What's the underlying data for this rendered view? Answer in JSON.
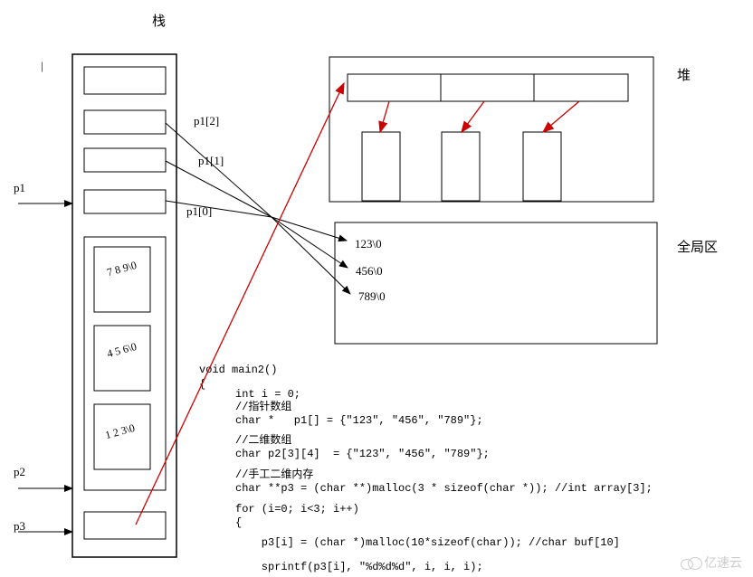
{
  "titles": {
    "stack": "栈",
    "heap": "堆",
    "global": "全局区"
  },
  "pointers": {
    "p1": "p1",
    "p2": "p2",
    "p3": "p3",
    "p1_0": "p1[0]",
    "p1_1": "p1[1]",
    "p1_2": "p1[2]"
  },
  "globals": {
    "s1": "123\\0",
    "s2": "456\\0",
    "s3": "789\\0"
  },
  "stack_cell_values": {
    "cell_a": "7 8 9\\0",
    "cell_b": "4 5 6\\0",
    "cell_c": "1 2 3\\0"
  },
  "code": {
    "fn": "void main2()",
    "brace": "{",
    "l1": "int i = 0;",
    "l2": "//指针数组",
    "l3": "char *   p1[] = {\"123\", \"456\", \"789\"};",
    "l4": "//二维数组",
    "l5": "char p2[3][4]  = {\"123\", \"456\", \"789\"};",
    "l6": "//手工二维内存",
    "l7": "char **p3 = (char **)malloc(3 * sizeof(char *)); //int array[3];",
    "l8": "for (i=0; i<3; i++)",
    "l9": "{",
    "l10": "    p3[i] = (char *)malloc(10*sizeof(char)); //char buf[10]",
    "l11": "    sprintf(p3[i], \"%d%d%d\", i, i, i);"
  },
  "marks": {
    "top_dash": "|"
  },
  "watermark": "亿速云"
}
